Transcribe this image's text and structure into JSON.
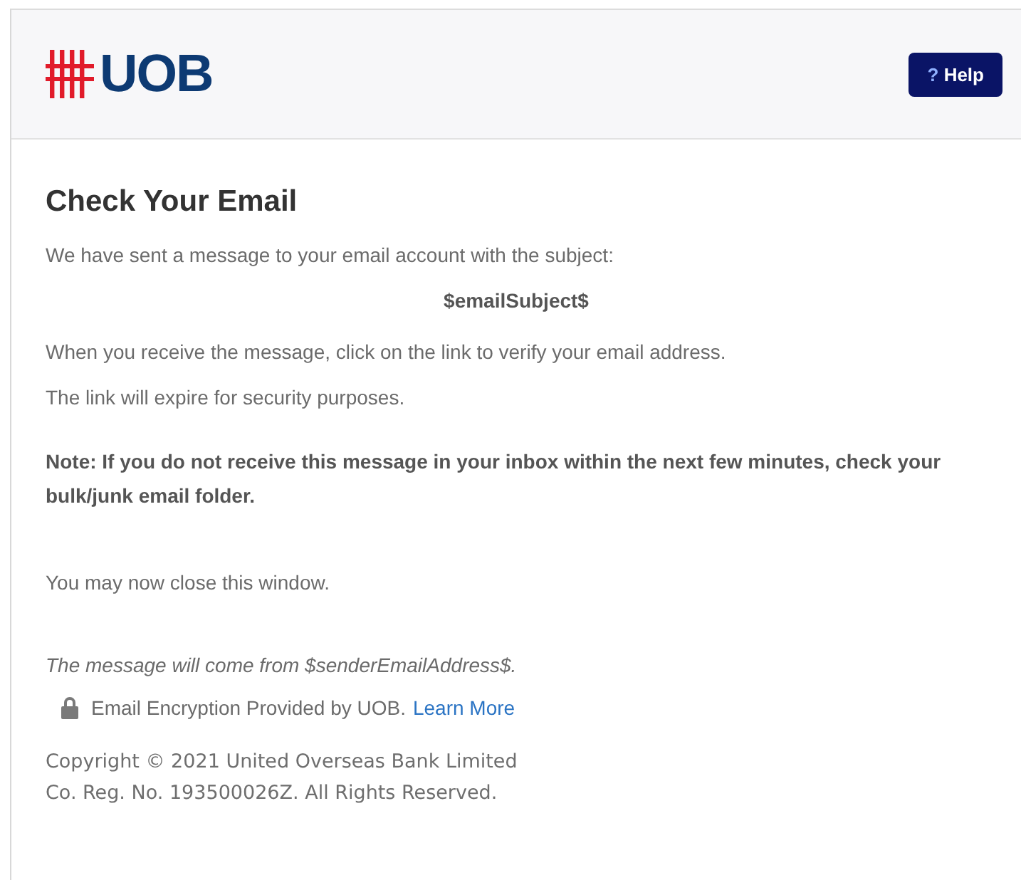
{
  "header": {
    "logo_text": "UOB",
    "help_button": {
      "glyph": "?",
      "label": "Help"
    }
  },
  "title": "Check Your Email",
  "intro": "We have sent a message to your email account with the subject:",
  "subject": "$emailSubject$",
  "paragraphs": [
    "When you receive the message, click on the link to verify your email address.",
    "The link will expire for security purposes."
  ],
  "note": "Note: If you do not receive this message in your inbox within the next few minutes, check your bulk/junk email folder.",
  "close_text": "You may now close this window.",
  "sender_text": "The message will come from $senderEmailAddress$.",
  "encryption": {
    "text": "Email Encryption Provided by UOB.",
    "link": "Learn More"
  },
  "copyright": [
    "Copyright © 2021 United Overseas Bank Limited",
    "Co. Reg. No. 193500026Z. All Rights Reserved."
  ]
}
